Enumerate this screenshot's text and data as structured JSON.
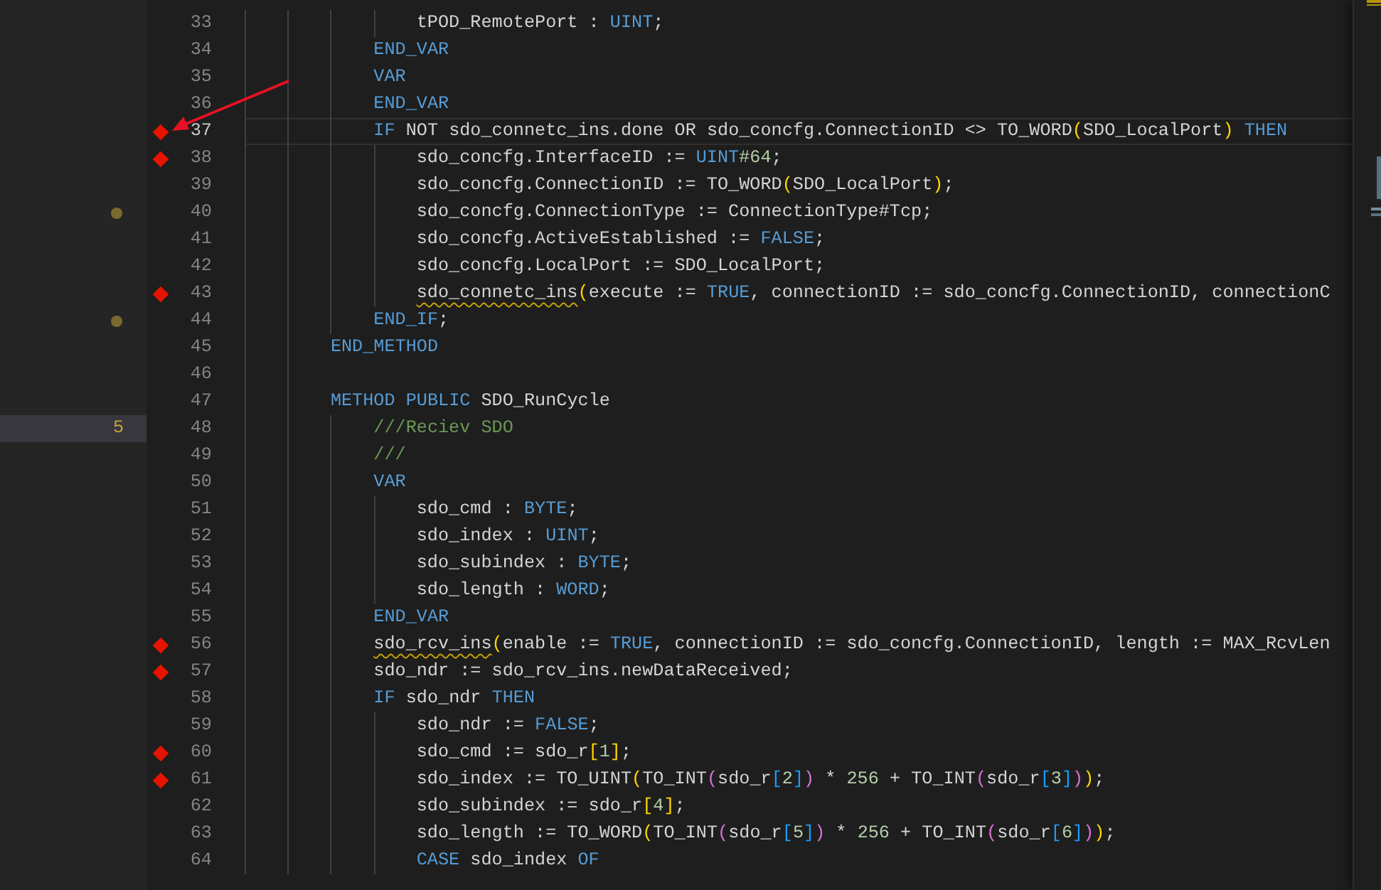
{
  "editor": {
    "lines": [
      {
        "number": "33",
        "breakpoint": false,
        "tokens": [
          {
            "text": "                tPOD_RemotePort : ",
            "kind": "plain"
          },
          {
            "text": "UINT",
            "kind": "keyword"
          },
          {
            "text": ";",
            "kind": "plain"
          }
        ]
      },
      {
        "number": "34",
        "breakpoint": false,
        "tokens": [
          {
            "text": "            END_VAR",
            "kind": "keyword"
          }
        ]
      },
      {
        "number": "35",
        "breakpoint": false,
        "tokens": [
          {
            "text": "            VAR",
            "kind": "keyword"
          }
        ]
      },
      {
        "number": "36",
        "breakpoint": false,
        "tokens": [
          {
            "text": "            END_VAR",
            "kind": "keyword"
          }
        ]
      },
      {
        "number": "37",
        "breakpoint": true,
        "current": true,
        "tokens": [
          {
            "text": "            IF",
            "kind": "keyword"
          },
          {
            "text": " NOT sdo_connetc_ins.done OR sdo_concfg.ConnectionID <> TO_WORD",
            "kind": "plain"
          },
          {
            "text": "(",
            "kind": "bracket1"
          },
          {
            "text": "SDO_LocalPort",
            "kind": "plain"
          },
          {
            "text": ")",
            "kind": "bracket1"
          },
          {
            "text": " THEN",
            "kind": "keyword"
          }
        ]
      },
      {
        "number": "38",
        "breakpoint": true,
        "tokens": [
          {
            "text": "                sdo_concfg.InterfaceID := ",
            "kind": "plain"
          },
          {
            "text": "UINT",
            "kind": "keyword"
          },
          {
            "text": "#64",
            "kind": "number"
          },
          {
            "text": ";",
            "kind": "plain"
          }
        ]
      },
      {
        "number": "39",
        "breakpoint": false,
        "tokens": [
          {
            "text": "                sdo_concfg.ConnectionID := TO_WORD",
            "kind": "plain"
          },
          {
            "text": "(",
            "kind": "bracket1"
          },
          {
            "text": "SDO_LocalPort",
            "kind": "plain"
          },
          {
            "text": ")",
            "kind": "bracket1"
          },
          {
            "text": ";",
            "kind": "plain"
          }
        ]
      },
      {
        "number": "40",
        "breakpoint": false,
        "margin": {
          "kind": "dot"
        },
        "tokens": [
          {
            "text": "                sdo_concfg.ConnectionType := ConnectionType#Tcp;",
            "kind": "plain"
          }
        ]
      },
      {
        "number": "41",
        "breakpoint": false,
        "tokens": [
          {
            "text": "                sdo_concfg.ActiveEstablished := ",
            "kind": "plain"
          },
          {
            "text": "FALSE",
            "kind": "keyword"
          },
          {
            "text": ";",
            "kind": "plain"
          }
        ]
      },
      {
        "number": "42",
        "breakpoint": false,
        "tokens": [
          {
            "text": "                sdo_concfg.LocalPort := SDO_LocalPort;",
            "kind": "plain"
          }
        ]
      },
      {
        "number": "43",
        "breakpoint": true,
        "tokens": [
          {
            "text": "                sdo_connetc_ins",
            "kind": "warning"
          },
          {
            "text": "(",
            "kind": "bracket1"
          },
          {
            "text": "execute := ",
            "kind": "plain"
          },
          {
            "text": "TRUE",
            "kind": "keyword"
          },
          {
            "text": ", connectionID := sdo_concfg.ConnectionID, connectionC",
            "kind": "plain"
          }
        ]
      },
      {
        "number": "44",
        "breakpoint": false,
        "margin": {
          "kind": "dot"
        },
        "tokens": [
          {
            "text": "            END_IF",
            "kind": "keyword"
          },
          {
            "text": ";",
            "kind": "plain"
          }
        ]
      },
      {
        "number": "45",
        "breakpoint": false,
        "tokens": [
          {
            "text": "        END_METHOD",
            "kind": "keyword"
          }
        ]
      },
      {
        "number": "46",
        "breakpoint": false
      },
      {
        "number": "47",
        "breakpoint": false,
        "tokens": [
          {
            "text": "        METHOD PUBLIC",
            "kind": "keyword"
          },
          {
            "text": " SDO_RunCycle",
            "kind": "plain"
          }
        ]
      },
      {
        "number": "48",
        "breakpoint": false,
        "margin": {
          "kind": "count",
          "text": "5"
        },
        "tokens": [
          {
            "text": "            ///Reciev SDO",
            "kind": "comment"
          }
        ]
      },
      {
        "number": "49",
        "breakpoint": false,
        "tokens": [
          {
            "text": "            ///",
            "kind": "comment"
          }
        ]
      },
      {
        "number": "50",
        "breakpoint": false,
        "tokens": [
          {
            "text": "            VAR",
            "kind": "keyword"
          }
        ]
      },
      {
        "number": "51",
        "breakpoint": false,
        "tokens": [
          {
            "text": "                sdo_cmd : ",
            "kind": "plain"
          },
          {
            "text": "BYTE",
            "kind": "keyword"
          },
          {
            "text": ";",
            "kind": "plain"
          }
        ]
      },
      {
        "number": "52",
        "breakpoint": false,
        "tokens": [
          {
            "text": "                sdo_index : ",
            "kind": "plain"
          },
          {
            "text": "UINT",
            "kind": "keyword"
          },
          {
            "text": ";",
            "kind": "plain"
          }
        ]
      },
      {
        "number": "53",
        "breakpoint": false,
        "tokens": [
          {
            "text": "                sdo_subindex : ",
            "kind": "plain"
          },
          {
            "text": "BYTE",
            "kind": "keyword"
          },
          {
            "text": ";",
            "kind": "plain"
          }
        ]
      },
      {
        "number": "54",
        "breakpoint": false,
        "tokens": [
          {
            "text": "                sdo_length : ",
            "kind": "plain"
          },
          {
            "text": "WORD",
            "kind": "keyword"
          },
          {
            "text": ";",
            "kind": "plain"
          }
        ]
      },
      {
        "number": "55",
        "breakpoint": false,
        "tokens": [
          {
            "text": "            END_VAR",
            "kind": "keyword"
          }
        ]
      },
      {
        "number": "56",
        "breakpoint": true,
        "tokens": [
          {
            "text": "            sdo_rcv_ins",
            "kind": "warning"
          },
          {
            "text": "(",
            "kind": "bracket1"
          },
          {
            "text": "enable := ",
            "kind": "plain"
          },
          {
            "text": "TRUE",
            "kind": "keyword"
          },
          {
            "text": ", connectionID := sdo_concfg.ConnectionID, length := MAX_RcvLen",
            "kind": "plain"
          }
        ]
      },
      {
        "number": "57",
        "breakpoint": true,
        "tokens": [
          {
            "text": "            sdo_ndr := sdo_rcv_ins.newDataReceived;",
            "kind": "plain"
          }
        ]
      },
      {
        "number": "58",
        "breakpoint": false,
        "tokens": [
          {
            "text": "            IF",
            "kind": "keyword"
          },
          {
            "text": " sdo_ndr ",
            "kind": "plain"
          },
          {
            "text": "THEN",
            "kind": "keyword"
          }
        ]
      },
      {
        "number": "59",
        "breakpoint": false,
        "tokens": [
          {
            "text": "                sdo_ndr := ",
            "kind": "plain"
          },
          {
            "text": "FALSE",
            "kind": "keyword"
          },
          {
            "text": ";",
            "kind": "plain"
          }
        ]
      },
      {
        "number": "60",
        "breakpoint": true,
        "tokens": [
          {
            "text": "                sdo_cmd := sdo_r",
            "kind": "plain"
          },
          {
            "text": "[",
            "kind": "bracket1"
          },
          {
            "text": "1",
            "kind": "number"
          },
          {
            "text": "]",
            "kind": "bracket1"
          },
          {
            "text": ";",
            "kind": "plain"
          }
        ]
      },
      {
        "number": "61",
        "breakpoint": true,
        "tokens": [
          {
            "text": "                sdo_index := TO_UINT",
            "kind": "plain"
          },
          {
            "text": "(",
            "kind": "bracket1"
          },
          {
            "text": "TO_INT",
            "kind": "plain"
          },
          {
            "text": "(",
            "kind": "bracket2"
          },
          {
            "text": "sdo_r",
            "kind": "plain"
          },
          {
            "text": "[",
            "kind": "bracket3"
          },
          {
            "text": "2",
            "kind": "number"
          },
          {
            "text": "]",
            "kind": "bracket3"
          },
          {
            "text": ")",
            "kind": "bracket2"
          },
          {
            "text": " * ",
            "kind": "plain"
          },
          {
            "text": "256",
            "kind": "number"
          },
          {
            "text": " + TO_INT",
            "kind": "plain"
          },
          {
            "text": "(",
            "kind": "bracket2"
          },
          {
            "text": "sdo_r",
            "kind": "plain"
          },
          {
            "text": "[",
            "kind": "bracket3"
          },
          {
            "text": "3",
            "kind": "number"
          },
          {
            "text": "]",
            "kind": "bracket3"
          },
          {
            "text": ")",
            "kind": "bracket2"
          },
          {
            "text": ")",
            "kind": "bracket1"
          },
          {
            "text": ";",
            "kind": "plain"
          }
        ]
      },
      {
        "number": "62",
        "breakpoint": false,
        "tokens": [
          {
            "text": "                sdo_subindex := sdo_r",
            "kind": "plain"
          },
          {
            "text": "[",
            "kind": "bracket1"
          },
          {
            "text": "4",
            "kind": "number"
          },
          {
            "text": "]",
            "kind": "bracket1"
          },
          {
            "text": ";",
            "kind": "plain"
          }
        ]
      },
      {
        "number": "63",
        "breakpoint": false,
        "tokens": [
          {
            "text": "                sdo_length := TO_WORD",
            "kind": "plain"
          },
          {
            "text": "(",
            "kind": "bracket1"
          },
          {
            "text": "TO_INT",
            "kind": "plain"
          },
          {
            "text": "(",
            "kind": "bracket2"
          },
          {
            "text": "sdo_r",
            "kind": "plain"
          },
          {
            "text": "[",
            "kind": "bracket3"
          },
          {
            "text": "5",
            "kind": "number"
          },
          {
            "text": "]",
            "kind": "bracket3"
          },
          {
            "text": ")",
            "kind": "bracket2"
          },
          {
            "text": " * ",
            "kind": "plain"
          },
          {
            "text": "256",
            "kind": "number"
          },
          {
            "text": " + TO_INT",
            "kind": "plain"
          },
          {
            "text": "(",
            "kind": "bracket2"
          },
          {
            "text": "sdo_r",
            "kind": "plain"
          },
          {
            "text": "[",
            "kind": "bracket3"
          },
          {
            "text": "6",
            "kind": "number"
          },
          {
            "text": "]",
            "kind": "bracket3"
          },
          {
            "text": ")",
            "kind": "bracket2"
          },
          {
            "text": ")",
            "kind": "bracket1"
          },
          {
            "text": ";",
            "kind": "plain"
          }
        ]
      },
      {
        "number": "64",
        "breakpoint": false,
        "tokens": [
          {
            "text": "                CASE",
            "kind": "keyword"
          },
          {
            "text": " sdo_index ",
            "kind": "plain"
          },
          {
            "text": "OF",
            "kind": "keyword"
          }
        ]
      }
    ]
  }
}
